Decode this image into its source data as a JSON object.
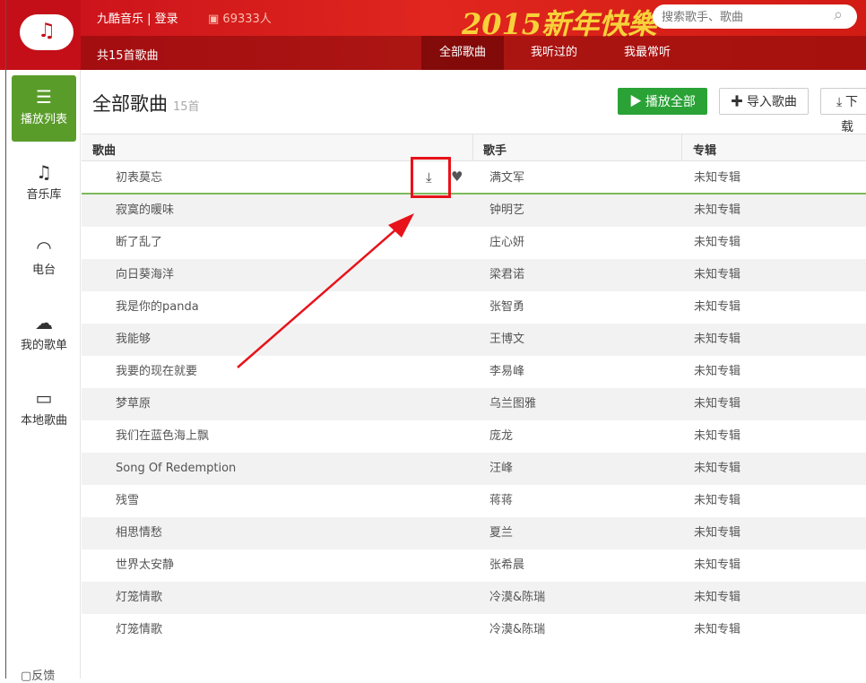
{
  "header": {
    "brand": "九酷音乐 | 登录",
    "online_count": "69333人",
    "banner": "2015新年快樂",
    "search_placeholder": "搜索歌手、歌曲",
    "song_count": "共15首歌曲",
    "tabs": [
      {
        "label": "全部歌曲",
        "active": true
      },
      {
        "label": "我听过的"
      },
      {
        "label": "我最常听"
      }
    ]
  },
  "sidebar": {
    "items": [
      {
        "label": "播放列表",
        "icon": "list-icon",
        "active": true
      },
      {
        "label": "音乐库",
        "icon": "music-note-icon"
      },
      {
        "label": "电台",
        "icon": "wifi-icon"
      },
      {
        "label": "我的歌单",
        "icon": "cloud-icon"
      },
      {
        "label": "本地歌曲",
        "icon": "monitor-icon"
      }
    ],
    "feedback": "反馈"
  },
  "main": {
    "title": "全部歌曲",
    "count": "15首",
    "buttons": {
      "play_all": "播放全部",
      "import": "导入歌曲",
      "download": "下载"
    },
    "columns": [
      "歌曲",
      "歌手",
      "专辑"
    ],
    "rows": [
      [
        "初表莫忘",
        "满文军",
        "未知专辑"
      ],
      [
        "寂寞的暖味",
        "钟明艺",
        "未知专辑"
      ],
      [
        "断了乱了",
        "庄心妍",
        "未知专辑"
      ],
      [
        "向日葵海洋",
        "梁君诺",
        "未知专辑"
      ],
      [
        "我是你的panda",
        "张智勇",
        "未知专辑"
      ],
      [
        "我能够",
        "王博文",
        "未知专辑"
      ],
      [
        "我要的现在就要",
        "李易峰",
        "未知专辑"
      ],
      [
        "梦草原",
        "乌兰图雅",
        "未知专辑"
      ],
      [
        "我们在蓝色海上飘",
        "庞龙",
        "未知专辑"
      ],
      [
        "Song Of Redemption",
        "汪峰",
        "未知专辑"
      ],
      [
        "残雪",
        "蒋蒋",
        "未知专辑"
      ],
      [
        "相思情愁",
        "夏兰",
        "未知专辑"
      ],
      [
        "世界太安静",
        "张希晨",
        "未知专辑"
      ],
      [
        "灯笼情歌",
        "冷漠&陈瑞",
        "未知专辑"
      ],
      [
        "灯笼情歌",
        "冷漠&陈瑞",
        "未知专辑"
      ]
    ]
  },
  "colors": {
    "header_red": "#d21b14",
    "accent_green": "#5a9c2a",
    "play_green": "#2aa236",
    "highlight_red": "#e8121a"
  }
}
